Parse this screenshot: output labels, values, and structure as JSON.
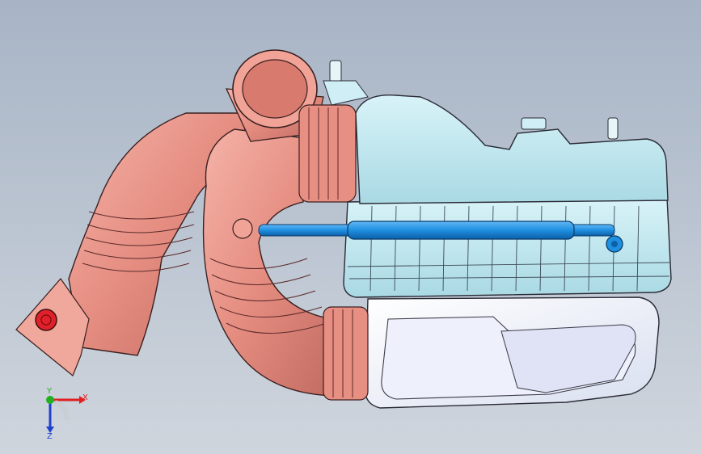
{
  "viewport": {
    "background_top": "#a8b4c6",
    "background_bottom": "#cfd5dd"
  },
  "model": {
    "intake_hose_color": "#e8958a",
    "air_box_color": "#bfe7ef",
    "air_box_base_color": "#f2f5fb",
    "rod_color": "#1f8fe0",
    "marker_color": "#e0202a"
  },
  "triad": {
    "x_label": "X",
    "y_label": "Y",
    "z_label": "Z",
    "x_color": "#e02020",
    "y_color": "#20b020",
    "z_color": "#2040d0"
  }
}
